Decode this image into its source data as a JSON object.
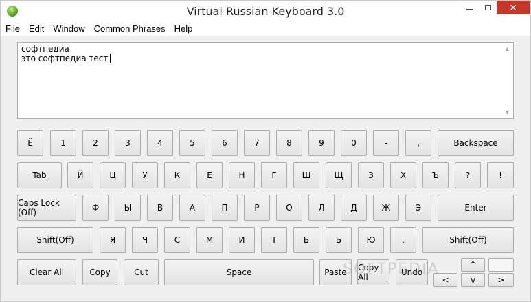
{
  "window": {
    "title": "Virtual Russian Keyboard 3.0"
  },
  "menu": [
    "File",
    "Edit",
    "Window",
    "Common Phrases",
    "Help"
  ],
  "editor": {
    "lines": [
      "софтпедиа",
      "это софтпедиа тест"
    ]
  },
  "scroll": {
    "up": "▲",
    "down": "▼"
  },
  "keys": {
    "row1": [
      "Ё",
      "1",
      "2",
      "3",
      "4",
      "5",
      "6",
      "7",
      "8",
      "9",
      "0",
      "-",
      ","
    ],
    "backspace": "Backspace",
    "tab": "Tab",
    "row2": [
      "Й",
      "Ц",
      "У",
      "К",
      "Е",
      "Н",
      "Г",
      "Ш",
      "Щ",
      "З",
      "Х",
      "Ъ",
      "?",
      "!"
    ],
    "capslock": "Caps Lock (Off)",
    "row3": [
      "Ф",
      "Ы",
      "В",
      "А",
      "П",
      "Р",
      "О",
      "Л",
      "Д",
      "Ж",
      "Э"
    ],
    "enter": "Enter",
    "shift_left": "Shift(Off)",
    "row4": [
      "Я",
      "Ч",
      "С",
      "М",
      "И",
      "Т",
      "Ь",
      "Б",
      "Ю",
      "."
    ],
    "shift_right": "Shift(Off)",
    "clear_all": "Clear All",
    "copy": "Copy",
    "cut": "Cut",
    "space": "Space",
    "paste": "Paste",
    "copy_all": "Copy All",
    "undo": "Undo",
    "arrow_up": "^",
    "arrow_left": "<",
    "arrow_down": "v",
    "arrow_right": ">"
  },
  "watermark": "SOFTPEDIA"
}
